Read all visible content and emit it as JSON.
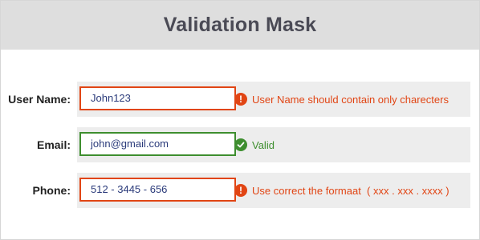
{
  "header": {
    "title": "Validation Mask"
  },
  "colors": {
    "error": "#e14514",
    "valid": "#3e8e2f",
    "header_bg": "#dedede",
    "panel_bg": "#ededed"
  },
  "form": {
    "username": {
      "label": "User Name:",
      "value": "John123",
      "status": "error",
      "message": "User Name should contain only charecters",
      "icon": "exclamation-icon"
    },
    "email": {
      "label": "Email:",
      "value": "john@gmail.com",
      "status": "valid",
      "message": "Valid",
      "icon": "checkmark-icon"
    },
    "phone": {
      "label": "Phone:",
      "value": "512 - 3445 - 656",
      "status": "error",
      "message": "Use correct the formaat  ( xxx . xxx . xxxx )",
      "icon": "exclamation-icon"
    }
  }
}
